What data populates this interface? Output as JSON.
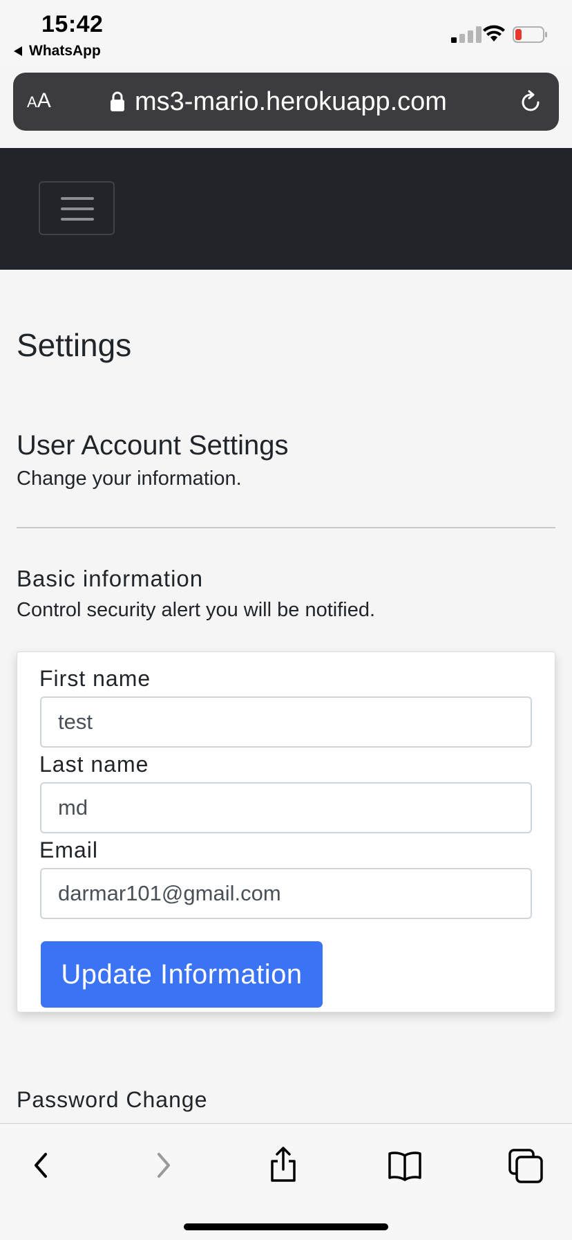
{
  "status_bar": {
    "time": "15:42",
    "back_app": "WhatsApp",
    "icons": [
      "signal-icon",
      "wifi-icon",
      "battery-icon"
    ]
  },
  "browser": {
    "text_size_button": "AA",
    "url": "ms3-mario.herokuapp.com",
    "icons": [
      "lock-icon",
      "reload-icon"
    ]
  },
  "navbar": {
    "toggler_icon": "hamburger-icon"
  },
  "page": {
    "title": "Settings",
    "account_section": {
      "title": "User Account Settings",
      "subtitle": "Change your information."
    },
    "basic_info": {
      "title": "Basic information",
      "subtitle": "Control security alert you will be notified.",
      "form": {
        "first_name_label": "First name",
        "first_name_value": "test",
        "last_name_label": "Last name",
        "last_name_value": "md",
        "email_label": "Email",
        "email_value": "darmar101@gmail.com",
        "submit_label": "Update Information"
      }
    },
    "password_section": {
      "title": "Password Change"
    }
  },
  "toolbar": {
    "icons": [
      "back-icon",
      "forward-icon",
      "share-icon",
      "bookmarks-icon",
      "tabs-icon"
    ]
  },
  "colors": {
    "navbar_bg": "#212529",
    "primary_button": "#3b73f5",
    "page_bg": "#f5f5f5",
    "battery_low": "#e8352d"
  }
}
